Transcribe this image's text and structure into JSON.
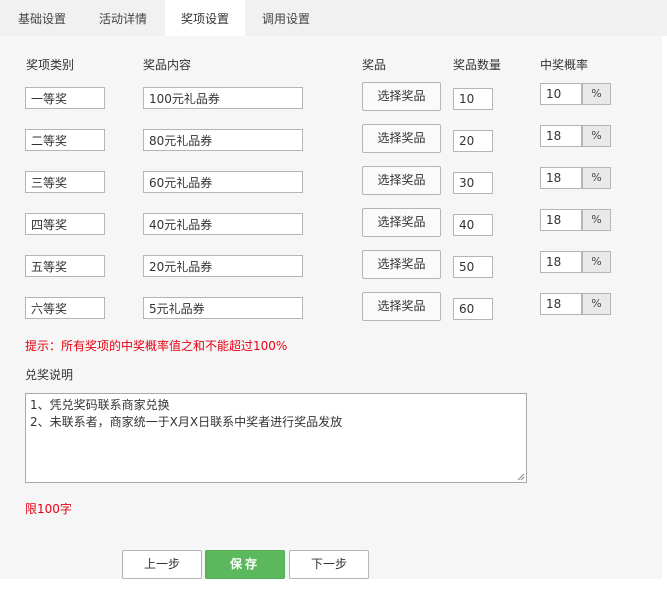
{
  "tabs": [
    {
      "label": "基础设置",
      "active": false
    },
    {
      "label": "活动详情",
      "active": false
    },
    {
      "label": "奖项设置",
      "active": true
    },
    {
      "label": "调用设置",
      "active": false
    }
  ],
  "headers": {
    "type": "奖项类别",
    "content": "奖品内容",
    "prize": "奖品",
    "qty": "奖品数量",
    "rate": "中奖概率"
  },
  "rows": [
    {
      "type": "一等奖",
      "content": "100元礼品券",
      "select_label": "选择奖品",
      "qty": "10",
      "rate": "10",
      "pct": "%"
    },
    {
      "type": "二等奖",
      "content": "80元礼品券",
      "select_label": "选择奖品",
      "qty": "20",
      "rate": "18",
      "pct": "%"
    },
    {
      "type": "三等奖",
      "content": "60元礼品券",
      "select_label": "选择奖品",
      "qty": "30",
      "rate": "18",
      "pct": "%"
    },
    {
      "type": "四等奖",
      "content": "40元礼品券",
      "select_label": "选择奖品",
      "qty": "40",
      "rate": "18",
      "pct": "%"
    },
    {
      "type": "五等奖",
      "content": "20元礼品券",
      "select_label": "选择奖品",
      "qty": "50",
      "rate": "18",
      "pct": "%"
    },
    {
      "type": "六等奖",
      "content": "5元礼品券",
      "select_label": "选择奖品",
      "qty": "60",
      "rate": "18",
      "pct": "%"
    }
  ],
  "tip": "提示：所有奖项的中奖概率值之和不能超过100%",
  "description": {
    "label": "兑奖说明",
    "lines": [
      "1、凭兑奖码联系商家兑换",
      "2、未联系者，商家统一于X月X日联系中奖者进行奖品发放"
    ],
    "limit": "限100字"
  },
  "footer": {
    "prev_label": "上一步",
    "save_label": "保存",
    "next_label": "下一步"
  },
  "colors": {
    "accent_green": "#5cb85c",
    "warning_red": "#e60012",
    "tab_bar_bg": "#f1f1f1",
    "panel_bg": "#f6f6f6"
  }
}
